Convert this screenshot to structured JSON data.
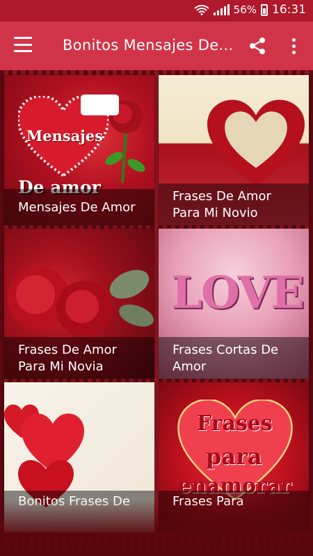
{
  "status": {
    "battery": "56%",
    "time": "16:31"
  },
  "appbar": {
    "title": "Bonitos Mensajes De..."
  },
  "cards": [
    {
      "label": "Mensajes De Amor",
      "art_text": [
        "Mensajes",
        "De amor"
      ]
    },
    {
      "label": "Frases De Amor\nPara Mi Novio"
    },
    {
      "label": "Frases De Amor\nPara Mi Novia"
    },
    {
      "label": "Frases Cortas De\nAmor",
      "art_text": [
        "LOVE"
      ]
    },
    {
      "label": "Bonitos Frases De"
    },
    {
      "label": "Frases Para",
      "art_text": [
        "Frases",
        "para",
        "enamorar"
      ]
    }
  ]
}
